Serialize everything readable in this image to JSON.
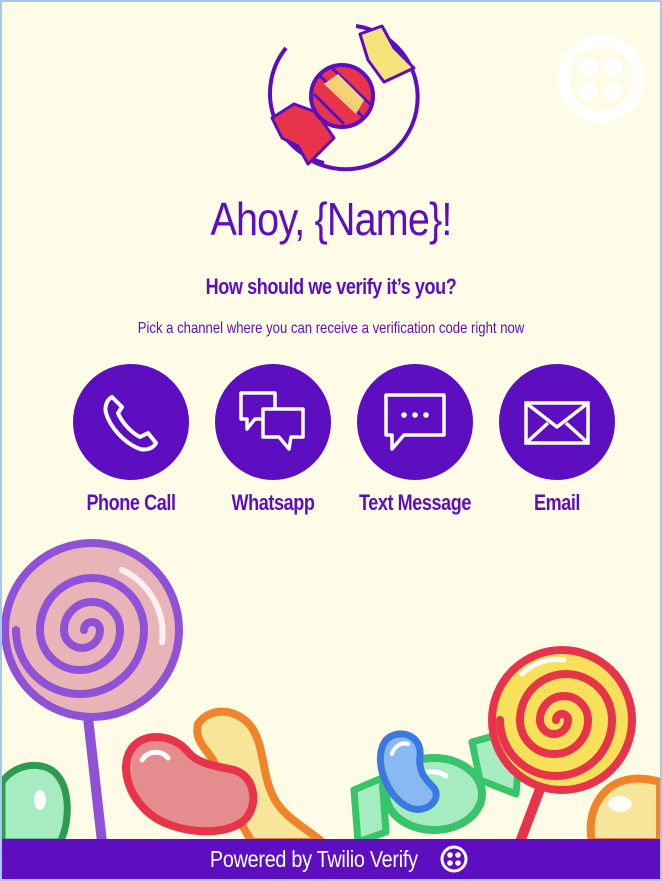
{
  "header": {
    "logo_icon": "candy-logo-icon",
    "corner_icon": "twilio-logo-icon"
  },
  "main": {
    "title": "Ahoy, {Name}!",
    "subtitle": "How should we verify it’s you?",
    "description": "Pick a channel where you can receive a verification code right now"
  },
  "channels": [
    {
      "label": "Phone Call",
      "icon": "phone-icon"
    },
    {
      "label": "Whatsapp",
      "icon": "chat-bubbles-icon"
    },
    {
      "label": "Text Message",
      "icon": "message-bubble-icon"
    },
    {
      "label": "Email",
      "icon": "envelope-icon"
    }
  ],
  "footer": {
    "text": "Powered by Twilio Verify",
    "icon": "twilio-logo-icon"
  },
  "colors": {
    "brand": "#5c0ec0",
    "background": "#fefbe6",
    "candy_red": "#e8344a",
    "candy_yellow": "#f8e37a"
  }
}
